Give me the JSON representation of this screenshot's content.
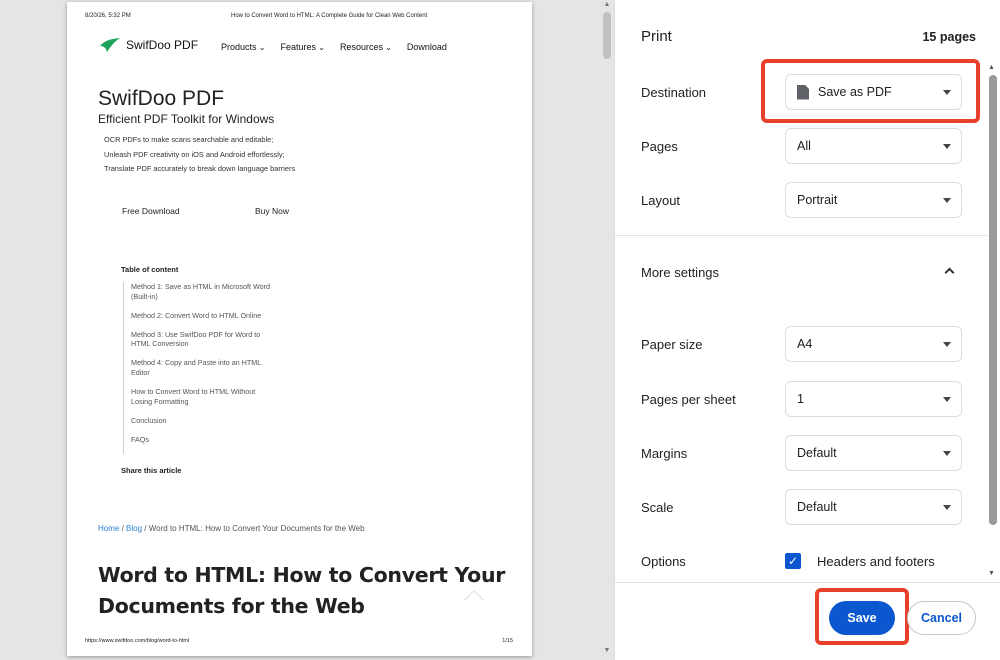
{
  "preview": {
    "header_date": "8/20/26, 5:32 PM",
    "header_title": "How to Convert Word to HTML: A Complete Guide for Clean Web Content",
    "logo_text": "SwifDoo PDF",
    "nav": [
      "Products",
      "Features",
      "Resources",
      "Download"
    ],
    "hero_title": "SwifDoo PDF",
    "hero_subtitle": "Efficient PDF Toolkit for Windows",
    "hero_lines": [
      "OCR PDFs to make scans searchable and editable;",
      "Unleash PDF creativity on iOS and Android effortlessly;",
      "Translate PDF accurately to break down language barriers"
    ],
    "free_download": "Free Download",
    "buy_now": "Buy Now",
    "toc_title": "Table of content",
    "toc_items": [
      "Method 1: Save as HTML in Microsoft Word (Built-in)",
      "Method 2: Convert Word to HTML Online",
      "Method 3: Use SwifDoo PDF for Word to HTML Conversion",
      "Method 4: Copy and Paste into an HTML Editor",
      "How to Convert Word to HTML Without Losing Formatting",
      "Conclusion",
      "FAQs"
    ],
    "share": "Share this article",
    "breadcrumb": {
      "home": "Home",
      "sep": "/",
      "blog": "Blog",
      "current": "Word to HTML: How to Convert Your Documents for the Web"
    },
    "article_title": "Word to HTML: How to Convert Your Documents for the Web",
    "footer_url": "https://www.swifdoo.com/blog/word-to-html",
    "footer_page": "1/15"
  },
  "panel": {
    "title": "Print",
    "page_count": "15 pages",
    "destination": {
      "label": "Destination",
      "value": "Save as PDF"
    },
    "pages": {
      "label": "Pages",
      "value": "All"
    },
    "layout": {
      "label": "Layout",
      "value": "Portrait"
    },
    "more_settings": "More settings",
    "paper_size": {
      "label": "Paper size",
      "value": "A4"
    },
    "pages_per_sheet": {
      "label": "Pages per sheet",
      "value": "1"
    },
    "margins": {
      "label": "Margins",
      "value": "Default"
    },
    "scale": {
      "label": "Scale",
      "value": "Default"
    },
    "options": {
      "label": "Options",
      "checkbox_label": "Headers and footers",
      "checked": true
    },
    "save": "Save",
    "cancel": "Cancel"
  },
  "colors": {
    "accent": "#0b57d0",
    "highlight": "#e8402a",
    "logo_green": "#1fa35b",
    "link": "#2b7fd4"
  }
}
